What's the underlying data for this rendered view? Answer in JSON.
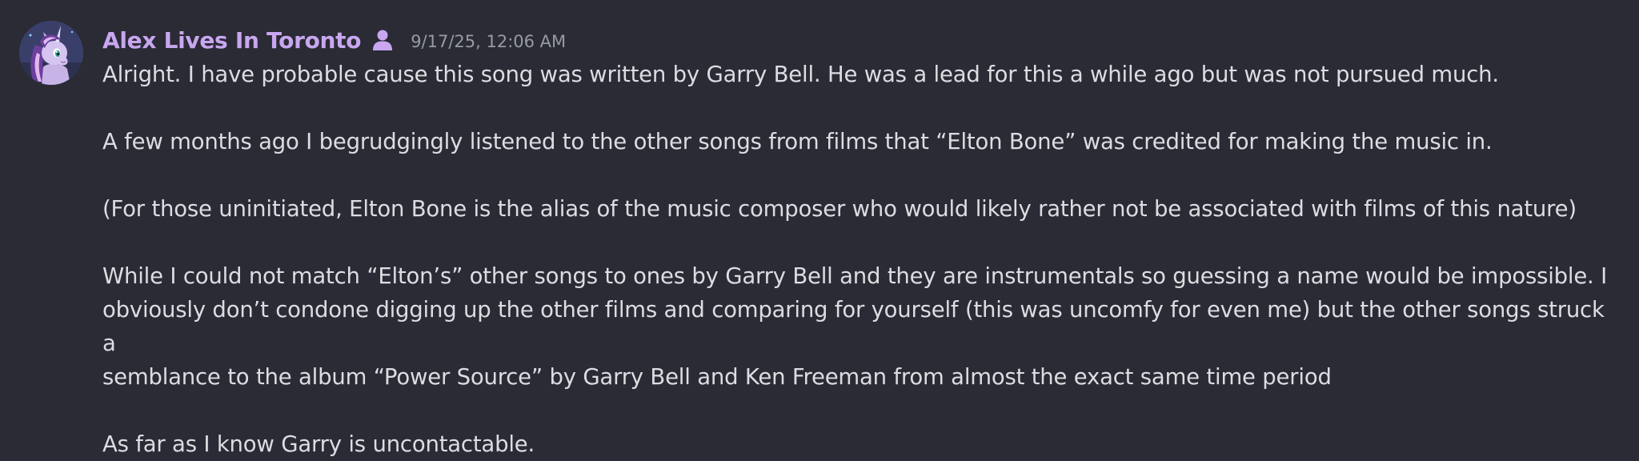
{
  "message": {
    "author": "Alex Lives In Toronto",
    "timestamp": "9/17/25, 12:06 AM",
    "role_icon": "user-icon",
    "paragraphs": [
      "Alright. I have probable cause this song was written by Garry Bell. He was a lead for this a while ago but was not pursued much.",
      "A few months ago I begrudgingly listened to the other songs from films that “Elton Bone” was credited for making the music in.",
      "(For those uninitiated, Elton Bone is the alias of the music composer who would likely rather not be associated with films of this nature)",
      "While I could not match “Elton’s” other songs to ones by Garry Bell and they are instrumentals so guessing a name would be impossible. I\nobviously don’t condone digging up the other films and comparing for yourself (this was uncomfy for even me) but the other songs struck a\nsemblance to the album “Power Source” by Garry Bell and Ken Freeman from almost the exact same time period",
      "As far as I know Garry is uncontactable."
    ]
  },
  "colors": {
    "background": "#2a2b35",
    "username": "#c9a7f0",
    "timestamp": "#949ba4",
    "text": "#dbdee1"
  }
}
